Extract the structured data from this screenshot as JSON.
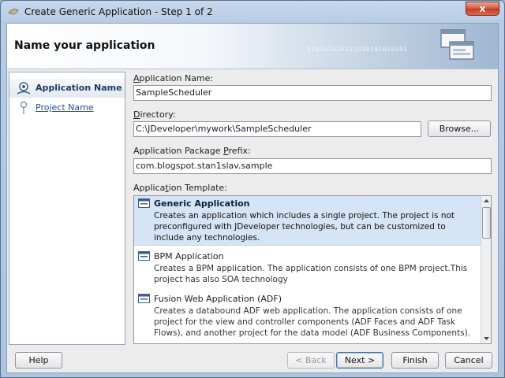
{
  "window": {
    "title": "Create Generic Application - Step 1 of 2",
    "close_label": "x"
  },
  "header": {
    "title": "Name your application",
    "decoration_text": "010101010101010101010101"
  },
  "nav": {
    "items": [
      {
        "label": "Application Name",
        "active": true
      },
      {
        "label": "Project Name",
        "active": false
      }
    ]
  },
  "form": {
    "app_name": {
      "label": "Application Name:",
      "mnemonic": "A",
      "label_rest": "pplication Name:",
      "value": "SampleScheduler"
    },
    "directory": {
      "label": "Directory:",
      "mnemonic": "D",
      "label_rest": "irectory:",
      "value": "C:\\JDeveloper\\mywork\\SampleScheduler",
      "browse_label": "Browse..."
    },
    "package_prefix": {
      "label": "Application Package Prefix:",
      "label_start": "Application Package ",
      "mnemonic": "P",
      "label_rest": "refix:",
      "value": "com.blogspot.stan1slav.sample"
    },
    "template": {
      "label": "Application Template:",
      "label_start": "Applica",
      "mnemonic": "t",
      "label_rest": "ion Template:"
    }
  },
  "templates": [
    {
      "title": "Generic Application",
      "description": "Creates an application which includes a single project. The project is not preconfigured with JDeveloper technologies, but can be customized to include any technologies.",
      "selected": true
    },
    {
      "title": "BPM Application",
      "description": "Creates a BPM application. The application consists of one BPM project.This project has also SOA technology",
      "selected": false
    },
    {
      "title": "Fusion Web Application (ADF)",
      "description": "Creates a databound ADF web application. The application consists of one project for the view and controller components (ADF Faces and ADF Task Flows), and another project for the data model (ADF Business Components).",
      "selected": false
    }
  ],
  "footer": {
    "help_label": "Help",
    "back_label": "< Back",
    "next_label": "Next >",
    "finish_label": "Finish",
    "cancel_label": "Cancel"
  },
  "colors": {
    "selected_row": "#d6e5f5",
    "link": "#1f4e9c",
    "close_button": "#c43a22"
  },
  "icons": {
    "app": "jdeveloper-icon",
    "header": "wizard-windows-icon",
    "nav_active": "nav-current-step-icon",
    "nav_other": "nav-step-icon",
    "template": "application-template-icon"
  }
}
